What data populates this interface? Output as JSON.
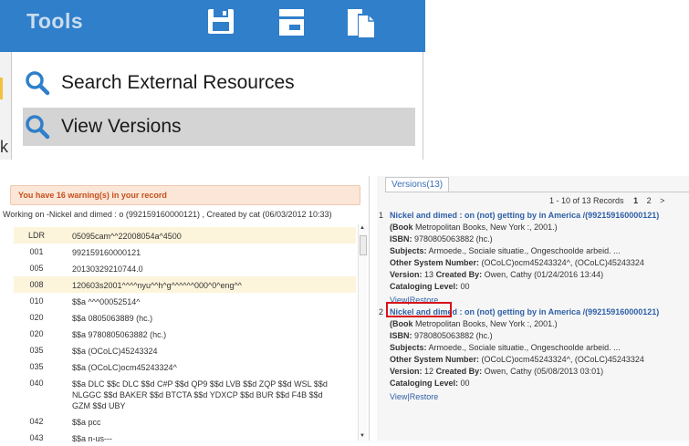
{
  "toolbar": {
    "title": "Tools",
    "icons": [
      "save-icon",
      "panel-icon",
      "copy-icon"
    ],
    "color": "#2f7fca"
  },
  "menu": {
    "items": [
      {
        "label": "Search External Resources",
        "icon": "search-icon",
        "highlighted": false
      },
      {
        "label": "View Versions",
        "icon": "search-icon",
        "highlighted": true
      }
    ],
    "left_fragment": "k"
  },
  "record": {
    "warning": "You have 16 warning(s) in your record",
    "working": "Working on -Nickel and dimed : o (992159160000121) , Created by cat (06/03/2012 10:33)",
    "fields": [
      {
        "tag": "LDR",
        "value": "05095cam^^22008054a^4500",
        "highlight": true
      },
      {
        "tag": "001",
        "value": "992159160000121",
        "highlight": false
      },
      {
        "tag": "005",
        "value": "20130329210744.0",
        "highlight": false
      },
      {
        "tag": "008",
        "value": "120603s2001^^^^nyu^^h^g^^^^^^000^0^eng^^",
        "highlight": true
      },
      {
        "tag": "010",
        "value": "$$a ^^^00052514^",
        "highlight": false
      },
      {
        "tag": "020",
        "value": "$$a 0805063889 (hc.)",
        "highlight": false
      },
      {
        "tag": "020",
        "value": "$$a 9780805063882 (hc.)",
        "highlight": false
      },
      {
        "tag": "035",
        "value": "$$a (OCoLC)45243324",
        "highlight": false
      },
      {
        "tag": "035",
        "value": "$$a (OCoLC)ocm45243324^",
        "highlight": false
      },
      {
        "tag": "040",
        "value": "$$a DLC $$c DLC $$d C#P $$d QP9 $$d LVB $$d ZQP $$d WSL $$d NLGGC $$d BAKER $$d BTCTA $$d YDXCP $$d BUR $$d F4B $$d GZM $$d UBY",
        "highlight": false
      },
      {
        "tag": "042",
        "value": "$$a pcc",
        "highlight": false
      },
      {
        "tag": "043",
        "value": "$$a n-us---",
        "highlight": false
      }
    ]
  },
  "versions": {
    "tab_label": "Versions(13)",
    "pager_text": "1 - 10 of 13 Records",
    "current_page": "1",
    "next_page": "2",
    "next_arrow": ">",
    "items": [
      {
        "num": "1",
        "title": "Nickel and dimed : on (not) getting by in America /(992159160000121)",
        "book_label": "(Book",
        "book": "Metropolitan Books, New York :, 2001.)",
        "isbn_label": "ISBN:",
        "isbn": "9780805063882 (hc.)",
        "subjects_label": "Subjects:",
        "subjects": "Armoede., Sociale situatie., Ongeschoolde arbeid. ...",
        "osn_label": "Other System Number:",
        "osn": "(OCoLC)ocm45243324^, (OCoLC)45243324",
        "version_label": "Version:",
        "version": "13",
        "created_label": "Created By:",
        "created": "Owen, Cathy (01/24/2016 13:44)",
        "cat_label": "Cataloging Level:",
        "cat": "00",
        "view": "View",
        "sep": "|",
        "restore": "Restore"
      },
      {
        "num": "2",
        "title": "Nickel and dimed : on (not) getting by in America /(992159160000121)",
        "book_label": "(Book",
        "book": "Metropolitan Books, New York :, 2001.)",
        "isbn_label": "ISBN:",
        "isbn": "9780805063882 (hc.)",
        "subjects_label": "Subjects:",
        "subjects": "Armoede., Sociale situatie., Ongeschoolde arbeid. ...",
        "osn_label": "Other System Number:",
        "osn": "(OCoLC)ocm45243324^, (OCoLC)45243324",
        "version_label": "Version:",
        "version": "12",
        "created_label": "Created By:",
        "created": "Owen, Cathy (05/08/2013 03:01)",
        "cat_label": "Cataloging Level:",
        "cat": "00",
        "view": "View",
        "sep": "|",
        "restore": "Restore"
      }
    ],
    "highlight_color": "#d8121a"
  }
}
